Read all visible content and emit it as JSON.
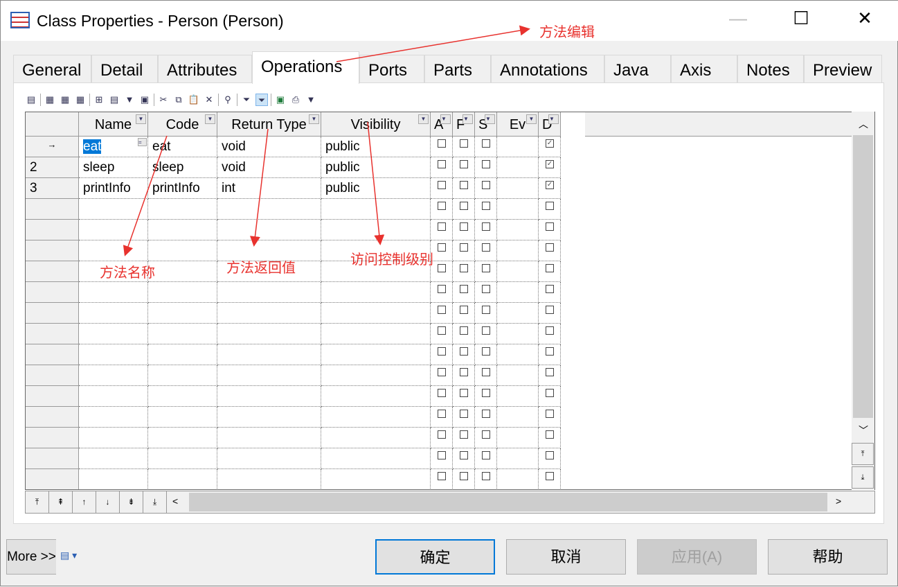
{
  "window": {
    "title": "Class Properties - Person (Person)",
    "minimize": "—",
    "maximize": "☐",
    "close": "✕"
  },
  "tabs": [
    "General",
    "Detail",
    "Attributes",
    "Operations",
    "Ports",
    "Parts",
    "Annotations",
    "Java",
    "Axis",
    "Notes",
    "Preview"
  ],
  "active_tab": "Operations",
  "columns": [
    "Name",
    "Code",
    "Return Type",
    "Visibility",
    "A",
    "F",
    "S",
    "Ev",
    "D"
  ],
  "rows": [
    {
      "num": "→",
      "name": "eat",
      "code": "eat",
      "return_type": "void",
      "visibility": "public",
      "a": false,
      "f": false,
      "s": false,
      "ev": "",
      "d": true
    },
    {
      "num": "2",
      "name": "sleep",
      "code": "sleep",
      "return_type": "void",
      "visibility": "public",
      "a": false,
      "f": false,
      "s": false,
      "ev": "",
      "d": true
    },
    {
      "num": "3",
      "name": "printInfo",
      "code": "printInfo",
      "return_type": "int",
      "visibility": "public",
      "a": false,
      "f": false,
      "s": false,
      "ev": "",
      "d": true
    }
  ],
  "empty_rows": 14,
  "annotations": {
    "tab": "方法编辑",
    "name": "方法名称",
    "return": "方法返回值",
    "visibility": "访问控制级别"
  },
  "buttons": {
    "more": "More >>",
    "ok": "确定",
    "cancel": "取消",
    "apply": "应用(A)",
    "help": "帮助"
  },
  "colors": {
    "annotation": "#e8322e",
    "selection": "#0078d7"
  }
}
